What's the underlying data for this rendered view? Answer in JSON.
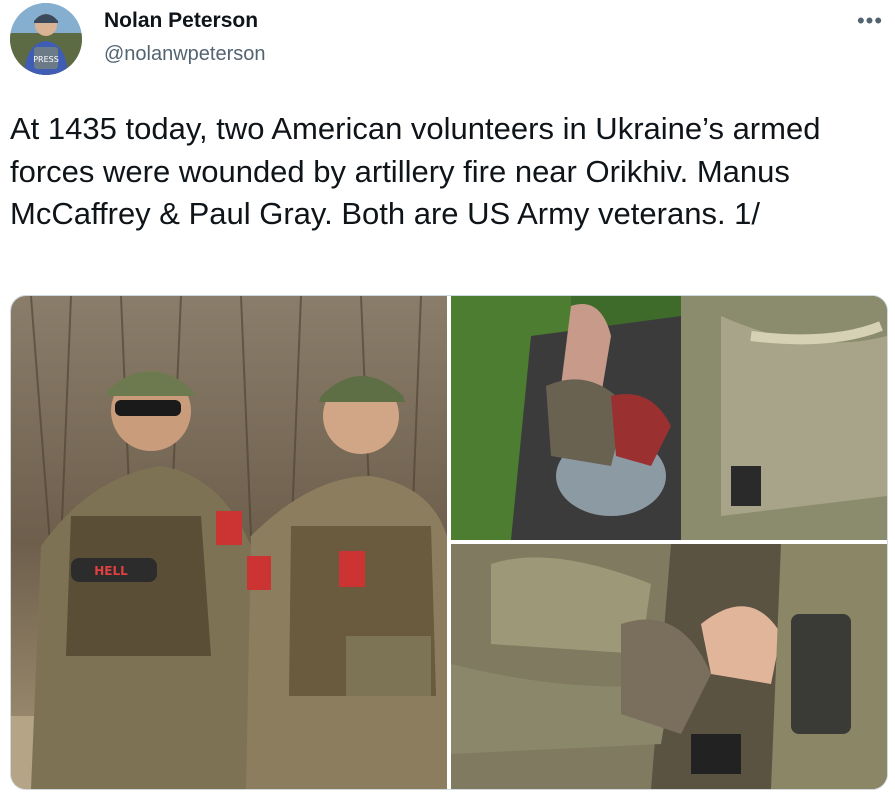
{
  "author": {
    "name": "Nolan Peterson",
    "handle": "@nolanwpeterson",
    "avatar_badge_text": "PRESS"
  },
  "menu": {
    "more_icon": "more-horizontal-icon",
    "more_glyph": "•••"
  },
  "tweet": {
    "text": "At 1435 today, two American volunteers in Ukraine’s armed forces were wounded by artillery fire near Orikhiv. Manus McCaffrey & Paul Gray. Both are US Army veterans. 1/"
  },
  "media": {
    "photo_count": 3,
    "photo1_can_label": "HELL"
  },
  "colors": {
    "text_primary": "#0f1419",
    "text_secondary": "#536471",
    "border": "#cfd9de"
  }
}
